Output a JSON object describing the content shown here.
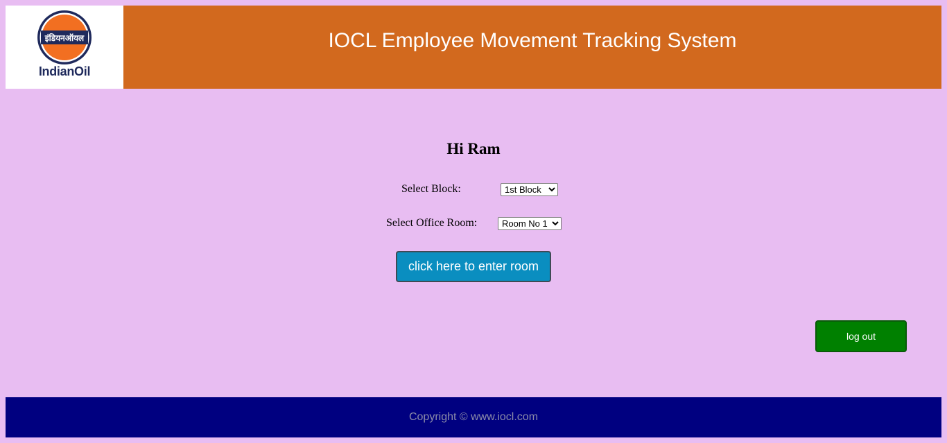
{
  "header": {
    "logo_hindi": "इंडियनऑयल",
    "logo_text": "IndianOil",
    "title": "IOCL Employee Movement Tracking System"
  },
  "main": {
    "greeting": "Hi Ram",
    "block_label": "Select Block:",
    "block_selected": "1st Block",
    "room_label": "Select Office Room:",
    "room_selected": "Room No 1",
    "enter_button": "click here to enter room",
    "logout_button": "log out"
  },
  "footer": {
    "copyright": "Copyright © www.iocl.com"
  },
  "colors": {
    "background": "#e8bdf2",
    "header": "#d2691e",
    "footer": "#000080",
    "enter_button": "#0a8ec0",
    "logout_button": "#008000",
    "logo_orange": "#f26f21",
    "logo_navy": "#1f2a5c"
  },
  "icons": {
    "logo": "indianoil-logo-icon"
  }
}
